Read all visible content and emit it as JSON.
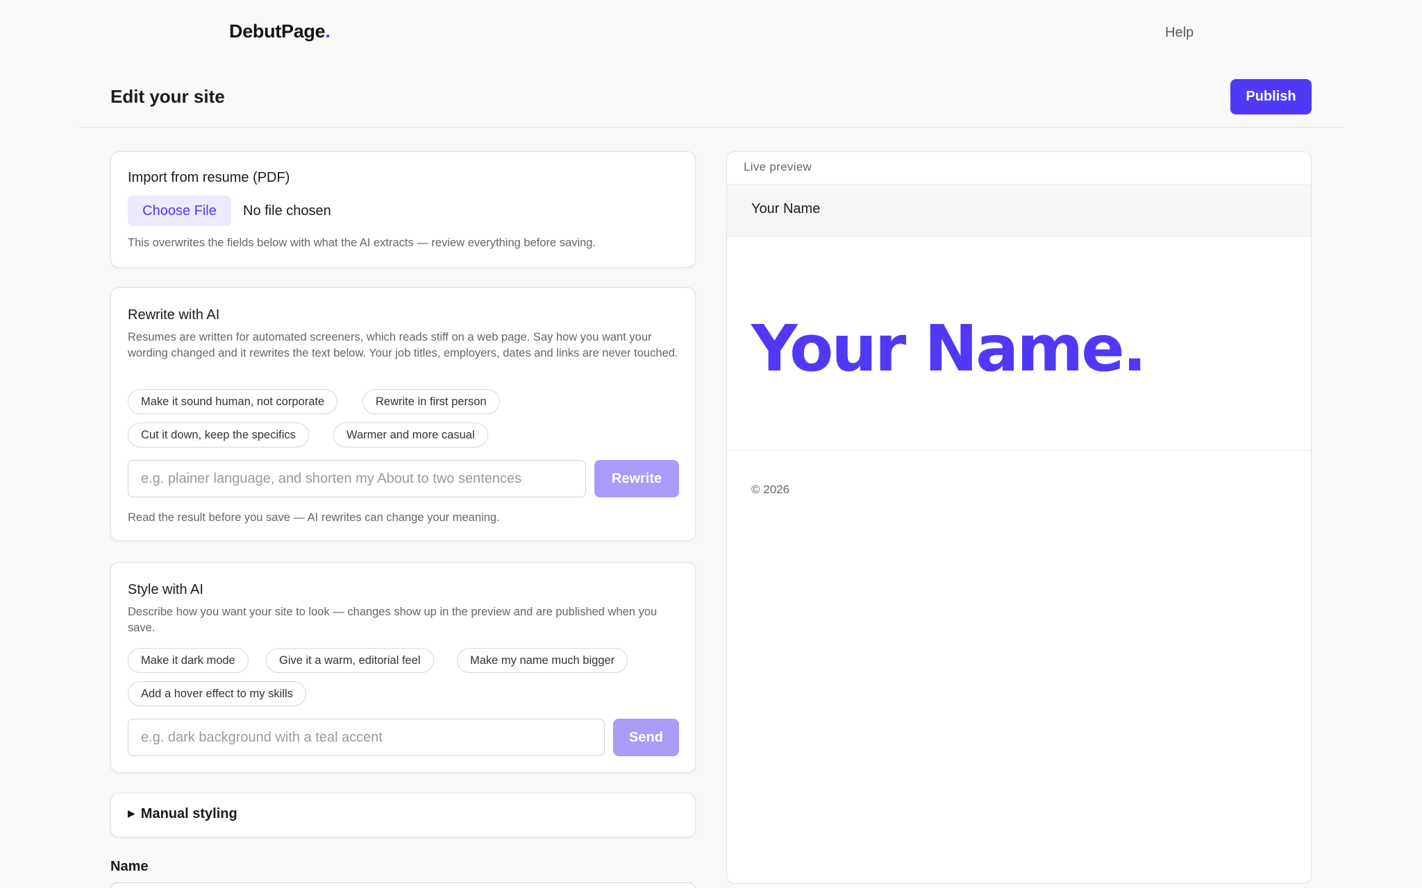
{
  "header": {
    "logo_text": "DebutPage",
    "logo_dot": ".",
    "help_label": "Help"
  },
  "page": {
    "title": "Edit your site",
    "publish_label": "Publish"
  },
  "import_card": {
    "title": "Import from resume (PDF)",
    "choose_file_label": "Choose File",
    "file_status": "No file chosen",
    "note": "This overwrites the fields below with what the AI extracts — review everything before saving."
  },
  "rewrite_card": {
    "title": "Rewrite with AI",
    "description": "Resumes are written for automated screeners, which reads stiff on a web page. Say how you want your wording changed and it rewrites the text below. Your job titles, employers, dates and links are never touched.",
    "chips": [
      "Make it sound human, not corporate",
      "Rewrite in first person",
      "Cut it down, keep the specifics",
      "Warmer and more casual"
    ],
    "input_placeholder": "e.g. plainer language, and shorten my About to two sentences",
    "button_label": "Rewrite",
    "note": "Read the result before you save — AI rewrites can change your meaning."
  },
  "style_card": {
    "title": "Style with AI",
    "description": "Describe how you want your site to look — changes show up in the preview and are published when you save.",
    "chips": [
      "Make it dark mode",
      "Give it a warm, editorial feel",
      "Make my name much bigger",
      "Add a hover effect to my skills"
    ],
    "input_placeholder": "e.g. dark background with a teal accent",
    "button_label": "Send"
  },
  "manual_styling": {
    "label": "Manual styling",
    "icon": "triangle-right-icon"
  },
  "fields": {
    "name_label": "Name"
  },
  "preview": {
    "label": "Live preview",
    "bar_name": "Your Name",
    "hero_name": "Your Name.",
    "footer": "© 2026"
  },
  "colors": {
    "accent": "#4f39f6",
    "accent_light": "#ede9fe",
    "accent_disabled": "#a99bf7",
    "background": "#f9f9f9"
  }
}
